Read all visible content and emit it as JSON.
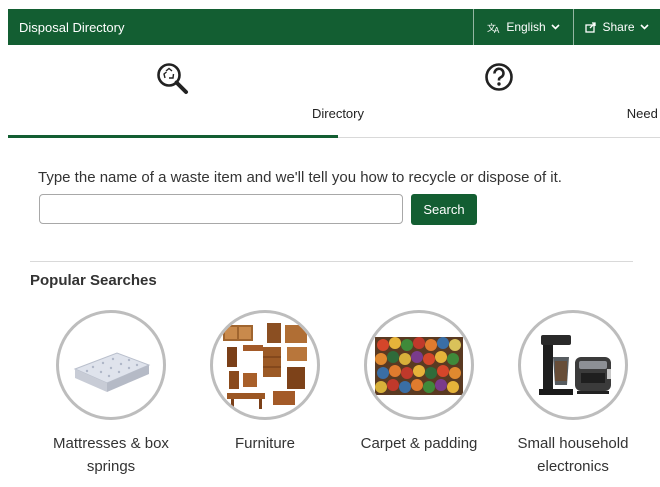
{
  "header": {
    "title": "Disposal Directory",
    "language_label": "English",
    "share_label": "Share"
  },
  "tabs": [
    {
      "label": "Directory",
      "icon": "recycle-search-icon",
      "active": true
    },
    {
      "label": "Need help?",
      "icon": "question-circle-icon",
      "active": false
    }
  ],
  "search": {
    "prompt": "Type the name of a waste item and we'll tell you how to recycle or dispose of it.",
    "value": "",
    "placeholder": "",
    "button_label": "Search"
  },
  "popular": {
    "title": "Popular Searches",
    "items": [
      {
        "label": "Mattresses & box springs",
        "image": "mattress"
      },
      {
        "label": "Furniture",
        "image": "furniture"
      },
      {
        "label": "Carpet & padding",
        "image": "carpet-rolls"
      },
      {
        "label": "Small household electronics",
        "image": "coffee-maker-toaster"
      }
    ]
  },
  "colors": {
    "brand_green": "#135e32",
    "circle_border": "#bdbdbd",
    "divider": "#d9d9d9"
  }
}
